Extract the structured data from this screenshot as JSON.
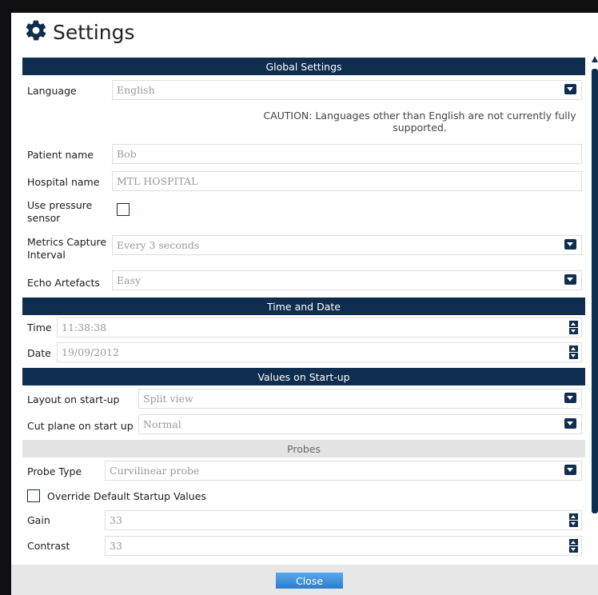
{
  "dialog": {
    "title": "Settings",
    "title_icon": "gear-icon",
    "close_label": "Close"
  },
  "global": {
    "header": "Global Settings",
    "language_label": "Language",
    "language_value": "English",
    "caution": "CAUTION: Languages other than English are not currently fully supported.",
    "patient_label": "Patient name",
    "patient_value": "Bob",
    "hospital_label": "Hospital name",
    "hospital_value": "MTL HOSPITAL",
    "pressure_label_1": "Use pressure",
    "pressure_label_2": "sensor",
    "pressure_checked": false,
    "metrics_label_1": "Metrics Capture",
    "metrics_label_2": "Interval",
    "metrics_value": "Every 3 seconds",
    "echo_label": "Echo Artefacts",
    "echo_value": "Easy"
  },
  "time_date": {
    "header": "Time and Date",
    "time_label": "Time",
    "time_value": "11:38:38",
    "date_label": "Date",
    "date_value": "19/09/2012"
  },
  "startup": {
    "header": "Values on Start-up",
    "layout_label": "Layout on start-up",
    "layout_value": "Split view",
    "cut_label": "Cut plane on start up",
    "cut_value": "Normal"
  },
  "probes": {
    "header": "Probes",
    "type_label": "Probe Type",
    "type_value": "Curvilinear probe",
    "override_label": "Override Default Startup Values",
    "override_checked": false,
    "gain_label": "Gain",
    "gain_value": "33",
    "contrast_label": "Contrast",
    "contrast_value": "33"
  },
  "colors": {
    "accent": "#0f2d4f",
    "button": "#3a8fdc"
  }
}
